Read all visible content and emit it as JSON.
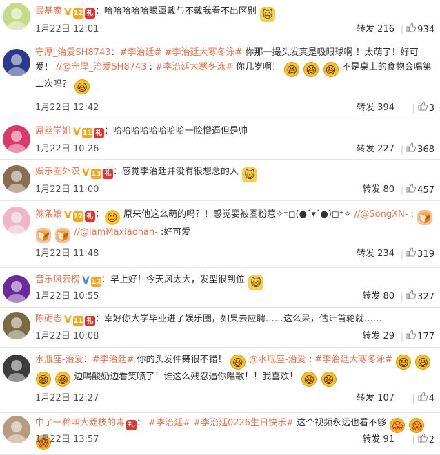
{
  "comments": [
    {
      "username": "最基腐",
      "badges": [
        "V",
        "12",
        "礼"
      ],
      "text_parts": [
        {
          "type": "text",
          "value": "哈哈哈哈哈眼罩戴与不戴我看不出区别"
        },
        {
          "type": "emoji",
          "icon": "cat-smile-emoji"
        }
      ],
      "time": "1月22日 12:01",
      "repost_label": "转发",
      "repost_count": "216",
      "like_count": "934",
      "avatar_color": "#c9d98a"
    },
    {
      "username": "守厚_治爱SH8743",
      "text_parts": [
        {
          "type": "topic",
          "value": "#李治廷#"
        },
        {
          "type": "topic",
          "value": "#李治廷大寒冬泳#"
        },
        {
          "type": "text",
          "value": "你那一撮头发真是吸眼球啊 ！太萌了！好可爱！"
        },
        {
          "type": "mention",
          "value": "//@守厚_治爱SH8743"
        },
        {
          "type": "text",
          "value": ":"
        },
        {
          "type": "topic",
          "value": "#李治廷大寒冬泳#"
        },
        {
          "type": "text",
          "value": "你几岁啊！"
        },
        {
          "type": "emoji",
          "icon": "laugh-emoji"
        },
        {
          "type": "emoji",
          "icon": "laugh-emoji"
        },
        {
          "type": "emoji",
          "icon": "laugh-emoji"
        },
        {
          "type": "text",
          "value": "不是桌上的食物会唱第二次吗？"
        },
        {
          "type": "emoji",
          "icon": "laugh-emoji"
        }
      ],
      "time": "1月22日 12:42",
      "repost_label": "转发",
      "repost_count": "394",
      "like_count": "3",
      "avatar_color": "#2b3a8c"
    },
    {
      "username": "屌丝学姐",
      "badges": [
        "V",
        "11",
        "礼"
      ],
      "text_parts": [
        {
          "type": "text",
          "value": "哈哈哈哈哈哈哈哈一脸懵逼但是帅"
        }
      ],
      "time": "1月22日 10:26",
      "repost_label": "转发",
      "repost_count": "227",
      "like_count": "368",
      "avatar_color": "#d83a6a"
    },
    {
      "username": "娱乐圈外汉",
      "badges": [
        "V",
        "13",
        "礼"
      ],
      "text_parts": [
        {
          "type": "text",
          "value": "感觉李治廷并没有很想念的人"
        },
        {
          "type": "emoji",
          "icon": "cat-smile-emoji"
        }
      ],
      "time": "1月22日 11:00",
      "repost_label": "转发",
      "repost_count": "80",
      "like_count": "457",
      "avatar_color": "#8b6d54"
    },
    {
      "username": "辣条娘",
      "badges": [
        "V",
        "12",
        "礼"
      ],
      "text_parts": [
        {
          "type": "emoji",
          "icon": "blush-emoji"
        },
        {
          "type": "text",
          "value": "原来他这么萌的吗？！感觉要被圈粉惹✧⁺◻(●˙▾˙●)◻⁺✧"
        },
        {
          "type": "mention",
          "value": "//@SongXN-"
        },
        {
          "type": "text",
          "value": ":"
        },
        {
          "type": "emoji",
          "icon": "bun-emoji"
        },
        {
          "type": "emoji",
          "icon": "bun-emoji"
        },
        {
          "type": "emoji",
          "icon": "bun-emoji"
        },
        {
          "type": "mention",
          "value": "//@iamMaxiaohan-"
        },
        {
          "type": "text",
          "value": ":好可爱"
        }
      ],
      "time": "1月22日 11:48",
      "repost_label": "转发",
      "repost_count": "234",
      "like_count": "319",
      "avatar_color": "#f0b5c8"
    },
    {
      "username": "音乐风云榜",
      "badges": [
        "VB",
        "12"
      ],
      "text_parts": [
        {
          "type": "text",
          "value": "早上好！今天风太大，发型很到位"
        },
        {
          "type": "emoji",
          "icon": "cat-smile-emoji"
        }
      ],
      "time": "1月22日 10:55",
      "repost_label": "转发",
      "repost_count": "80",
      "like_count": "327",
      "avatar_color": "#6b2b9c"
    },
    {
      "username": "陈砺志",
      "badges": [
        "V",
        "11",
        "礼"
      ],
      "text_parts": [
        {
          "type": "text",
          "value": "幸好你大学毕业进了娱乐圈，如果去应聘……这么呆，估计首轮就……"
        }
      ],
      "time": "1月22日 10:08",
      "repost_label": "转发",
      "repost_count": "29",
      "like_count": "177",
      "avatar_color": "#7a6a45"
    },
    {
      "username": "水瓶座-治爱",
      "text_parts": [
        {
          "type": "topic",
          "value": "#李治廷#"
        },
        {
          "type": "text",
          "value": "你的头发件舞很不错！"
        },
        {
          "type": "emoji",
          "icon": "laugh-emoji"
        },
        {
          "type": "mention",
          "value": "@水瓶座-治爱"
        },
        {
          "type": "text",
          "value": ":"
        },
        {
          "type": "topic",
          "value": "#李治廷大寒冬泳#"
        },
        {
          "type": "emoji",
          "icon": "laugh-emoji"
        },
        {
          "type": "emoji",
          "icon": "laugh-emoji"
        },
        {
          "type": "emoji",
          "icon": "laugh-emoji"
        },
        {
          "type": "emoji",
          "icon": "laugh-emoji"
        },
        {
          "type": "text",
          "value": "边喝酸奶边看笑喷了！谁这么残忍逼你唱歌！！我喜欢！"
        },
        {
          "type": "emoji",
          "icon": "laugh-emoji"
        },
        {
          "type": "emoji",
          "icon": "laugh-emoji"
        }
      ],
      "time": "1月22日 12:27",
      "repost_label": "转发",
      "repost_count": "107",
      "like_count": "4",
      "avatar_color": "#3d3d3d"
    },
    {
      "username": "中了一种叫大荔枝的毒",
      "badges": [
        "礼"
      ],
      "text_parts": [
        {
          "type": "text",
          "value": "："
        },
        {
          "type": "topic",
          "value": "#李治廷#"
        },
        {
          "type": "topic",
          "value": "#李治廷0226生日快乐#"
        },
        {
          "type": "text",
          "value": "这个视频永远也看不够"
        },
        {
          "type": "emoji",
          "icon": "shock-emoji"
        },
        {
          "type": "emoji",
          "icon": "shock-emoji"
        },
        {
          "type": "emoji",
          "icon": "shock-emoji"
        }
      ],
      "time": "1月22日 13:57",
      "repost_label": "转发",
      "repost_count": "91",
      "like_count": "2",
      "avatar_color": "#b89a7e"
    }
  ]
}
